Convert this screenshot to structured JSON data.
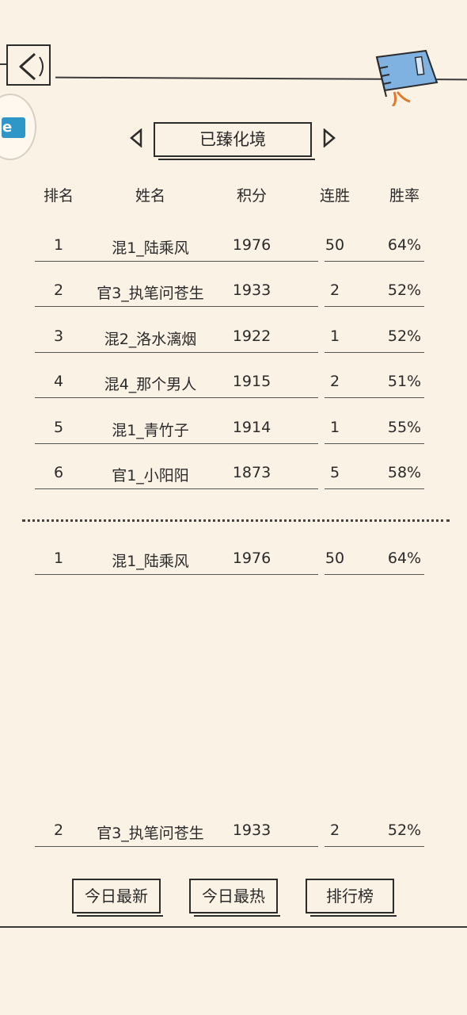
{
  "nav": {
    "back_icon": "back-arrow-icon",
    "book_icon": "book-icon"
  },
  "tier": {
    "label": "已臻化境",
    "prev_icon": "triangle-left-icon",
    "next_icon": "triangle-right-icon"
  },
  "table": {
    "headers": [
      "排名",
      "姓名",
      "积分",
      "连胜",
      "胜率"
    ],
    "rows": [
      [
        "1",
        "混1_陆乘风",
        "1976",
        "50",
        "64%"
      ],
      [
        "2",
        "官3_执笔问苍生",
        "1933",
        "2",
        "52%"
      ],
      [
        "3",
        "混2_洛水漓烟",
        "1922",
        "1",
        "52%"
      ],
      [
        "4",
        "混4_那个男人",
        "1915",
        "2",
        "51%"
      ],
      [
        "5",
        "混1_青竹子",
        "1914",
        "1",
        "55%"
      ],
      [
        "6",
        "官1_小阳阳",
        "1873",
        "5",
        "58%"
      ]
    ]
  },
  "highlight_rows": [
    [
      "1",
      "混1_陆乘风",
      "1976",
      "50",
      "64%"
    ],
    [
      "2",
      "官3_执笔问苍生",
      "1933",
      "2",
      "52%"
    ]
  ],
  "buttons": {
    "today_newest": "今日最新",
    "today_hottest": "今日最热",
    "leaderboard": "排行榜"
  }
}
